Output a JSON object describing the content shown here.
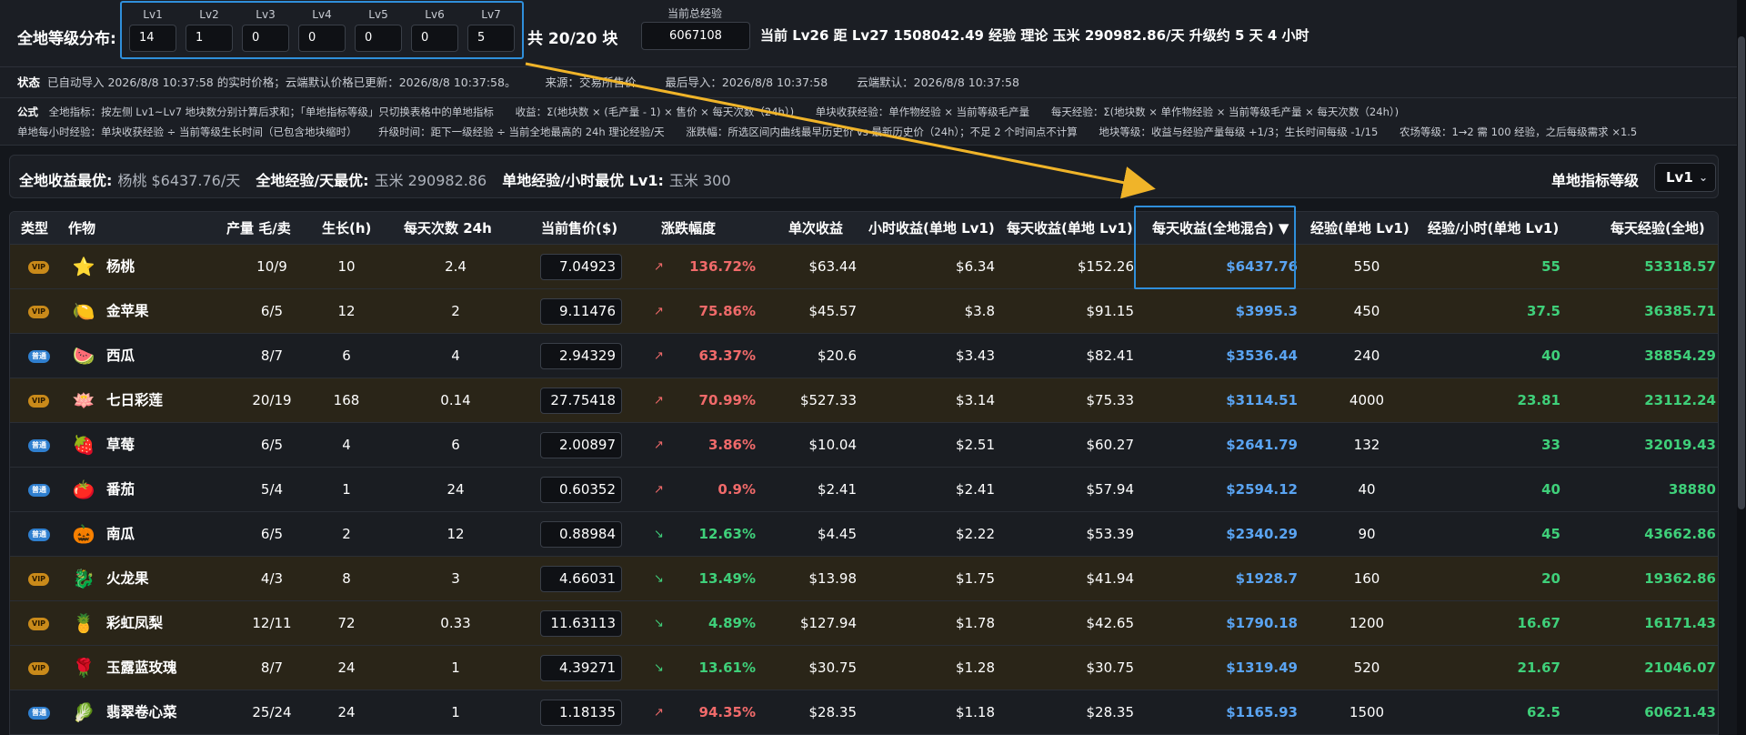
{
  "top": {
    "dist_label": "全地等级分布:",
    "levels": [
      {
        "name": "Lv1",
        "value": "14"
      },
      {
        "name": "Lv2",
        "value": "1"
      },
      {
        "name": "Lv3",
        "value": "0"
      },
      {
        "name": "Lv4",
        "value": "0"
      },
      {
        "name": "Lv5",
        "value": "0"
      },
      {
        "name": "Lv6",
        "value": "0"
      },
      {
        "name": "Lv7",
        "value": "5"
      }
    ],
    "block_count": "共 20/20 块",
    "total_exp_label": "当前总经验",
    "total_exp_value": "6067108",
    "level_summary": "当前 Lv26  距 Lv27 1508042.49 经验  理论 玉米 290982.86/天  升级约 5 天 4 小时"
  },
  "status": {
    "label": "状态",
    "text": "已自动导入 2026/8/8 10:37:58 的实时价格；云端默认价格已更新：2026/8/8 10:37:58。",
    "source": "来源：交易所售价",
    "last_import": "最后导入：2026/8/8 10:37:58",
    "cloud_default": "云端默认：2026/8/8 10:37:58"
  },
  "formulas": {
    "label": "公式",
    "line1": [
      "全地指标：按左侧 Lv1~Lv7 地块数分别计算后求和；「单地指标等级」只切换表格中的单地指标",
      "收益：Σ(地块数 × (毛产量 - 1) × 售价 × 每天次数（24h）)",
      "单块收获经验：单作物经验 × 当前等级毛产量",
      "每天经验：Σ(地块数 × 单作物经验 × 当前等级毛产量 × 每天次数（24h）)"
    ],
    "line2": [
      "单地每小时经验：单块收获经验 ÷ 当前等级生长时间（已包含地块缩时）",
      "升级时间：距下一级经验 ÷ 当前全地最高的 24h 理论经验/天",
      "涨跌幅：所选区间内曲线最早历史价 vs 最新历史价（24h）；不足 2 个时间点不计算",
      "地块等级：收益与经验产量每级 +1/3；生长时间每级 -1/15",
      "农场等级：1→2 需 100 经验，之后每级需求 ×1.5"
    ]
  },
  "best": {
    "income_label": "全地收益最优:",
    "income_value": "杨桃 $6437.76/天",
    "exp_label": "全地经验/天最优:",
    "exp_value": "玉米 290982.86",
    "single_label": "单地经验/小时最优 Lv1:",
    "single_value": "玉米 300",
    "level_select_label": "单地指标等级",
    "level_select_value": "Lv1"
  },
  "table": {
    "headers": {
      "type": "类型",
      "crop": "作物",
      "yield": "产量 毛/卖",
      "growth": "生长(h)",
      "times": "每天次数 24h",
      "price": "当前售价($)",
      "change": "涨跌幅度",
      "single_income": "单次收益",
      "hour_income": "小时收益(单地 Lv1)",
      "day_income": "每天收益(单地 Lv1)",
      "day_income_all": "每天收益(全地混合) ▼",
      "exp": "经验(单地 Lv1)",
      "exp_hour": "经验/小时(单地 Lv1)",
      "exp_day_all": "每天经验(全地)"
    },
    "rows": [
      {
        "badge": "VIP",
        "tier": "vip",
        "icon": "star-fruit-icon",
        "glyph": "⭐",
        "name": "杨桃",
        "yield": "10/9",
        "growth": "10",
        "times": "2.4",
        "price": "7.04923",
        "dir": "up",
        "arrow": "↗",
        "pct": "136.72%",
        "single": "$63.44",
        "hour": "$6.34",
        "day": "$152.26",
        "day_all": "$6437.76",
        "exp": "550",
        "exp_hour": "55",
        "exp_day": "53318.57"
      },
      {
        "badge": "VIP",
        "tier": "vip",
        "icon": "golden-apple-icon",
        "glyph": "🍋",
        "name": "金苹果",
        "yield": "6/5",
        "growth": "12",
        "times": "2",
        "price": "9.11476",
        "dir": "up",
        "arrow": "↗",
        "pct": "75.86%",
        "single": "$45.57",
        "hour": "$3.8",
        "day": "$91.15",
        "day_all": "$3995.3",
        "exp": "450",
        "exp_hour": "37.5",
        "exp_day": "36385.71"
      },
      {
        "badge": "普通",
        "tier": "normal",
        "icon": "watermelon-icon",
        "glyph": "🍉",
        "name": "西瓜",
        "yield": "8/7",
        "growth": "6",
        "times": "4",
        "price": "2.94329",
        "dir": "up",
        "arrow": "↗",
        "pct": "63.37%",
        "single": "$20.6",
        "hour": "$3.43",
        "day": "$82.41",
        "day_all": "$3536.44",
        "exp": "240",
        "exp_hour": "40",
        "exp_day": "38854.29"
      },
      {
        "badge": "VIP",
        "tier": "vip",
        "icon": "lotus-icon",
        "glyph": "🪷",
        "name": "七日彩莲",
        "yield": "20/19",
        "growth": "168",
        "times": "0.14",
        "price": "27.75418",
        "dir": "up",
        "arrow": "↗",
        "pct": "70.99%",
        "single": "$527.33",
        "hour": "$3.14",
        "day": "$75.33",
        "day_all": "$3114.51",
        "exp": "4000",
        "exp_hour": "23.81",
        "exp_day": "23112.24"
      },
      {
        "badge": "普通",
        "tier": "normal",
        "icon": "strawberry-icon",
        "glyph": "🍓",
        "name": "草莓",
        "yield": "6/5",
        "growth": "4",
        "times": "6",
        "price": "2.00897",
        "dir": "up",
        "arrow": "↗",
        "pct": "3.86%",
        "single": "$10.04",
        "hour": "$2.51",
        "day": "$60.27",
        "day_all": "$2641.79",
        "exp": "132",
        "exp_hour": "33",
        "exp_day": "32019.43"
      },
      {
        "badge": "普通",
        "tier": "normal",
        "icon": "tomato-icon",
        "glyph": "🍅",
        "name": "番茄",
        "yield": "5/4",
        "growth": "1",
        "times": "24",
        "price": "0.60352",
        "dir": "up",
        "arrow": "↗",
        "pct": "0.9%",
        "single": "$2.41",
        "hour": "$2.41",
        "day": "$57.94",
        "day_all": "$2594.12",
        "exp": "40",
        "exp_hour": "40",
        "exp_day": "38880"
      },
      {
        "badge": "普通",
        "tier": "normal",
        "icon": "pumpkin-icon",
        "glyph": "🎃",
        "name": "南瓜",
        "yield": "6/5",
        "growth": "2",
        "times": "12",
        "price": "0.88984",
        "dir": "down",
        "arrow": "↘",
        "pct": "12.63%",
        "single": "$4.45",
        "hour": "$2.22",
        "day": "$53.39",
        "day_all": "$2340.29",
        "exp": "90",
        "exp_hour": "45",
        "exp_day": "43662.86"
      },
      {
        "badge": "VIP",
        "tier": "vip",
        "icon": "dragon-fruit-icon",
        "glyph": "🐉",
        "name": "火龙果",
        "yield": "4/3",
        "growth": "8",
        "times": "3",
        "price": "4.66031",
        "dir": "down",
        "arrow": "↘",
        "pct": "13.49%",
        "single": "$13.98",
        "hour": "$1.75",
        "day": "$41.94",
        "day_all": "$1928.7",
        "exp": "160",
        "exp_hour": "20",
        "exp_day": "19362.86"
      },
      {
        "badge": "VIP",
        "tier": "vip",
        "icon": "rainbow-pineapple-icon",
        "glyph": "🍍",
        "name": "彩虹凤梨",
        "yield": "12/11",
        "growth": "72",
        "times": "0.33",
        "price": "11.63113",
        "dir": "down",
        "arrow": "↘",
        "pct": "4.89%",
        "single": "$127.94",
        "hour": "$1.78",
        "day": "$42.65",
        "day_all": "$1790.18",
        "exp": "1200",
        "exp_hour": "16.67",
        "exp_day": "16171.43"
      },
      {
        "badge": "VIP",
        "tier": "vip",
        "icon": "blue-rose-icon",
        "glyph": "🌹",
        "name": "玉露蓝玫瑰",
        "yield": "8/7",
        "growth": "24",
        "times": "1",
        "price": "4.39271",
        "dir": "down",
        "arrow": "↘",
        "pct": "13.61%",
        "single": "$30.75",
        "hour": "$1.28",
        "day": "$30.75",
        "day_all": "$1319.49",
        "exp": "520",
        "exp_hour": "21.67",
        "exp_day": "21046.07"
      },
      {
        "badge": "普通",
        "tier": "normal",
        "icon": "cabbage-icon",
        "glyph": "🥬",
        "name": "翡翠卷心菜",
        "yield": "25/24",
        "growth": "24",
        "times": "1",
        "price": "1.18135",
        "dir": "up",
        "arrow": "↗",
        "pct": "94.35%",
        "single": "$28.35",
        "hour": "$1.18",
        "day": "$28.35",
        "day_all": "$1165.93",
        "exp": "1500",
        "exp_hour": "62.5",
        "exp_day": "60621.43"
      }
    ]
  },
  "colors": {
    "accent": "#2f8fdb",
    "annotation_arrow": "#f0b429",
    "up": "#f06a6a",
    "down": "#3fd07a",
    "income_blue": "#5aa4f2",
    "vip_row": "#2a2518"
  }
}
